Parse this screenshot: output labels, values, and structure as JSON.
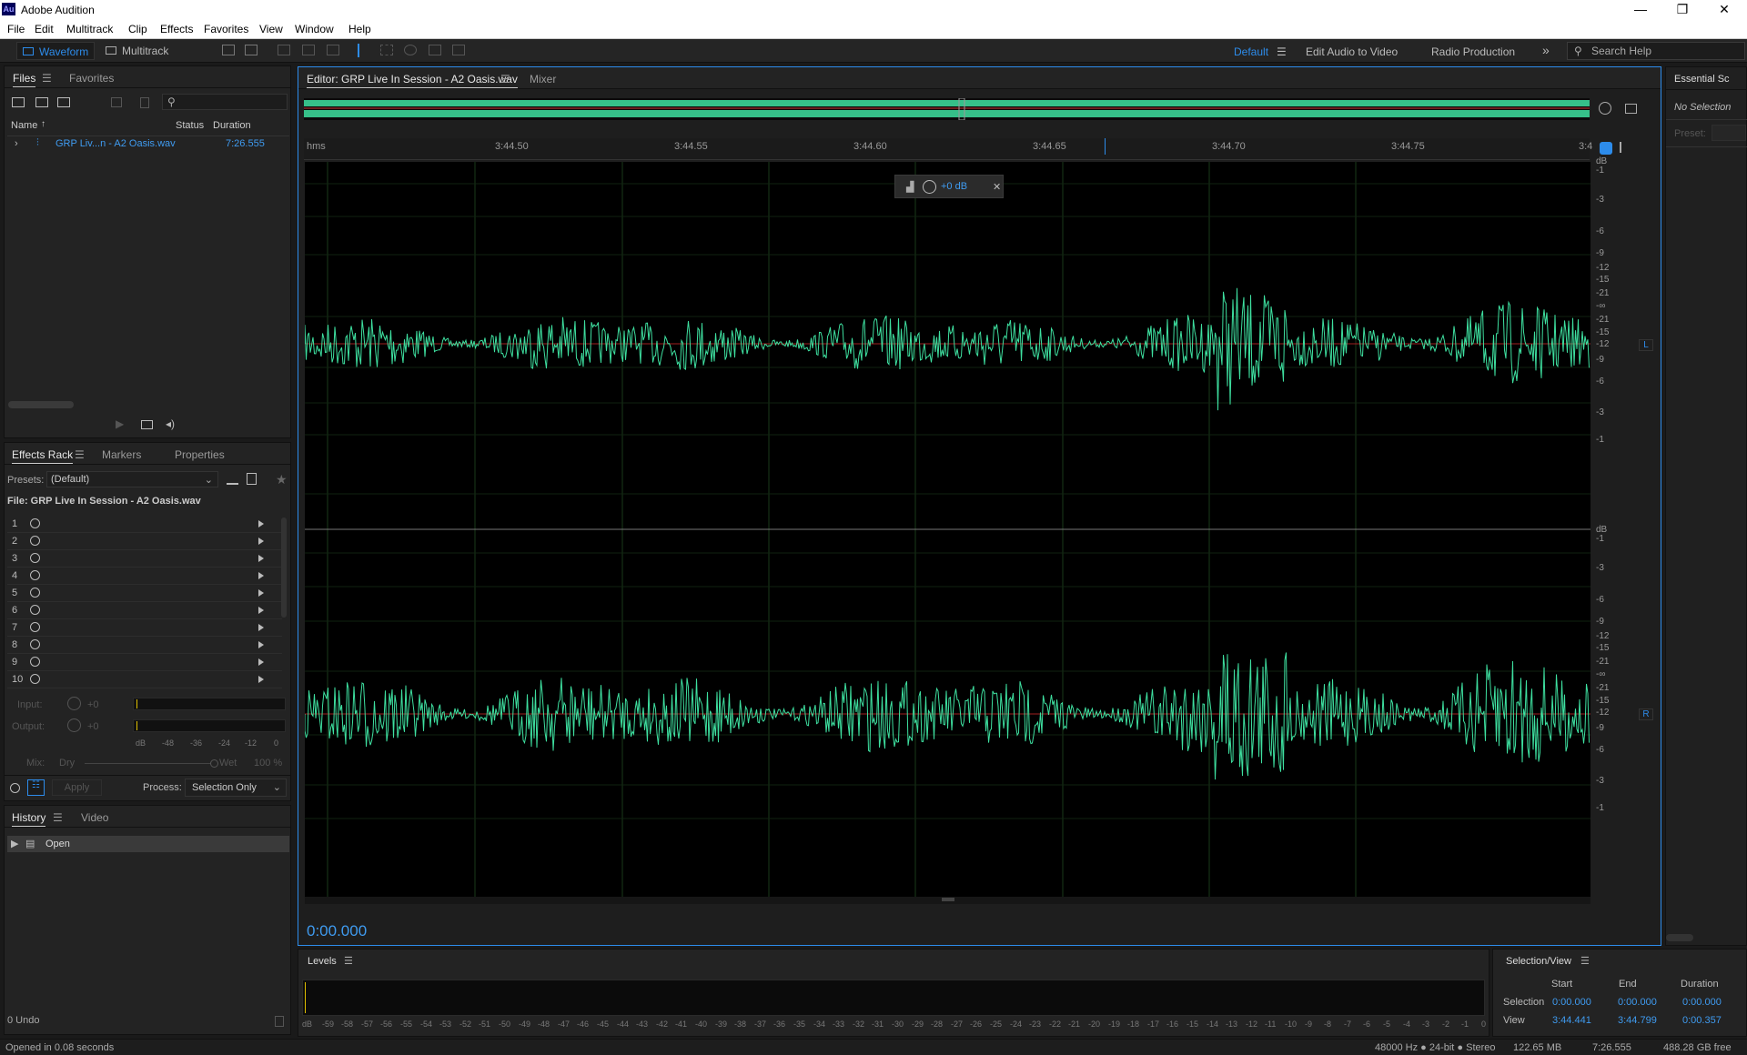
{
  "app": {
    "title": "Adobe Audition",
    "logo": "Au"
  },
  "menu": [
    "File",
    "Edit",
    "Multitrack",
    "Clip",
    "Effects",
    "Favorites",
    "View",
    "Window",
    "Help"
  ],
  "toolbar": {
    "waveform": "Waveform",
    "multitrack": "Multitrack"
  },
  "workspaces": {
    "default": "Default",
    "edit_av": "Edit Audio to Video",
    "radio": "Radio Production",
    "more": "»"
  },
  "search": {
    "placeholder": "Search Help"
  },
  "files": {
    "tabs": [
      "Files",
      "Favorites"
    ],
    "headers": {
      "name": "Name",
      "status": "Status",
      "duration": "Duration"
    },
    "items": [
      {
        "name": "GRP Liv...n - A2 Oasis.wav",
        "duration": "7:26.555"
      }
    ]
  },
  "effects": {
    "tabs": [
      "Effects Rack",
      "Markers",
      "Properties"
    ],
    "presets_label": "Presets:",
    "preset_value": "(Default)",
    "file_label": "File: GRP Live In Session - A2 Oasis.wav",
    "slots": [
      "1",
      "2",
      "3",
      "4",
      "5",
      "6",
      "7",
      "8",
      "9",
      "10"
    ],
    "input_label": "Input:",
    "output_label": "Output:",
    "gain": "+0",
    "meter_scale": [
      "dB",
      "-48",
      "-36",
      "-24",
      "-12",
      "0"
    ],
    "mix_label": "Mix:",
    "dry": "Dry",
    "wet": "Wet",
    "mix_value": "100 %",
    "apply": "Apply",
    "process_label": "Process:",
    "process_value": "Selection Only"
  },
  "history": {
    "tabs": [
      "History",
      "Video"
    ],
    "items": [
      "Open"
    ],
    "undo": "0 Undo"
  },
  "editor": {
    "tab": "Editor: GRP Live In Session - A2 Oasis.wav",
    "mixer": "Mixer",
    "ruler": [
      "hms",
      "3:44.50",
      "3:44.55",
      "3:44.60",
      "3:44.65",
      "3:44.70",
      "3:44.75",
      "3:4"
    ],
    "hud_gain": "+0 dB",
    "db_scale": [
      "dB",
      "-1",
      "-3",
      "-6",
      "-9",
      "-12",
      "-15",
      "-21",
      "-∞",
      "-21",
      "-15",
      "-12",
      "-9",
      "-6",
      "-3",
      "-1"
    ],
    "channel_l": "L",
    "channel_r": "R",
    "time": "0:00.000",
    "wave_color": "#3ee0a0"
  },
  "levels": {
    "title": "Levels",
    "scale": [
      "dB",
      "-59",
      "-58",
      "-57",
      "-56",
      "-55",
      "-54",
      "-53",
      "-52",
      "-51",
      "-50",
      "-49",
      "-48",
      "-47",
      "-46",
      "-45",
      "-44",
      "-43",
      "-42",
      "-41",
      "-40",
      "-39",
      "-38",
      "-37",
      "-36",
      "-35",
      "-34",
      "-33",
      "-32",
      "-31",
      "-30",
      "-29",
      "-28",
      "-27",
      "-26",
      "-25",
      "-24",
      "-23",
      "-22",
      "-21",
      "-20",
      "-19",
      "-18",
      "-17",
      "-16",
      "-15",
      "-14",
      "-13",
      "-12",
      "-11",
      "-10",
      "-9",
      "-8",
      "-7",
      "-6",
      "-5",
      "-4",
      "-3",
      "-2",
      "-1",
      "0"
    ]
  },
  "essential": {
    "title": "Essential Sc",
    "no_selection": "No Selection",
    "preset": "Preset:"
  },
  "selection_view": {
    "title": "Selection/View",
    "headers": [
      "Start",
      "End",
      "Duration"
    ],
    "selection": {
      "label": "Selection",
      "start": "0:00.000",
      "end": "0:00.000",
      "duration": "0:00.000"
    },
    "view": {
      "label": "View",
      "start": "3:44.441",
      "end": "3:44.799",
      "duration": "0:00.357"
    }
  },
  "status": {
    "left": "Opened in 0.08 seconds",
    "format": "48000 Hz ● 24-bit ● Stereo",
    "size": "122.65 MB",
    "duration": "7:26.555",
    "free": "488.28 GB free"
  }
}
